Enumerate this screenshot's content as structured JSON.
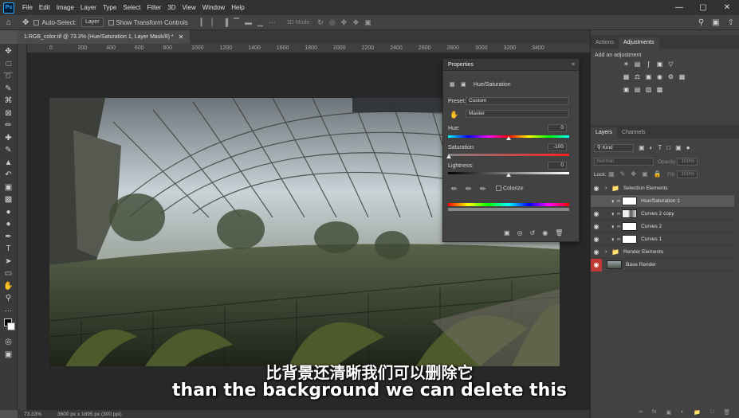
{
  "menubar": {
    "items": [
      "File",
      "Edit",
      "Image",
      "Layer",
      "Type",
      "Select",
      "Filter",
      "3D",
      "View",
      "Window",
      "Help"
    ]
  },
  "options": {
    "auto_select_label": "Auto-Select:",
    "auto_select_value": "Layer",
    "show_transform_label": "Show Transform Controls",
    "mode_3d": "3D Mode:"
  },
  "document": {
    "tab_title": "1.RGB_color.tif @ 73.3% (Hue/Saturation 1, Layer Mask/8) *",
    "ruler_ticks": [
      "0",
      "200",
      "400",
      "600",
      "800",
      "1000",
      "1200",
      "1400",
      "1600",
      "1800",
      "2000",
      "2200",
      "2400",
      "2600",
      "2800",
      "3000",
      "3200",
      "3400"
    ],
    "zoom": "73.33%",
    "doc_info": "3600 px x 1895 px (300 ppi)"
  },
  "properties": {
    "title": "Properties",
    "panel_type": "Hue/Saturation",
    "preset_label": "Preset:",
    "preset_value": "Custom",
    "channel_value": "Master",
    "hue_label": "Hue:",
    "hue_value": "0",
    "saturation_label": "Saturation:",
    "saturation_value": "-100",
    "lightness_label": "Lightness:",
    "lightness_value": "0",
    "colorize_label": "Colorize"
  },
  "right_panels": {
    "tabs_top": [
      "Actions",
      "Adjustments"
    ],
    "add_adjustment": "Add an adjustment",
    "tabs_layers": [
      "Layers",
      "Channels"
    ],
    "kind_label": "Kind",
    "blend_mode": "Normal",
    "opacity_label": "Opacity:",
    "opacity_value": "100%",
    "lock_label": "Lock:",
    "fill_label": "Fill:",
    "fill_value": "100%",
    "layers": [
      {
        "name": "Selection Elements",
        "type": "group"
      },
      {
        "name": "Hue/Saturation 1",
        "type": "adjustment"
      },
      {
        "name": "Curves 2 copy",
        "type": "adjustment"
      },
      {
        "name": "Curves 2",
        "type": "adjustment"
      },
      {
        "name": "Curves 1",
        "type": "adjustment"
      },
      {
        "name": "Render Elements",
        "type": "group"
      },
      {
        "name": "Base Render",
        "type": "pixel"
      }
    ]
  },
  "subtitles": {
    "zh": "比背景还清晰我们可以删除它",
    "en": "than the background we can delete this"
  },
  "colors": {
    "accent": "#31a8ff",
    "red_eye": "#c03a33"
  }
}
